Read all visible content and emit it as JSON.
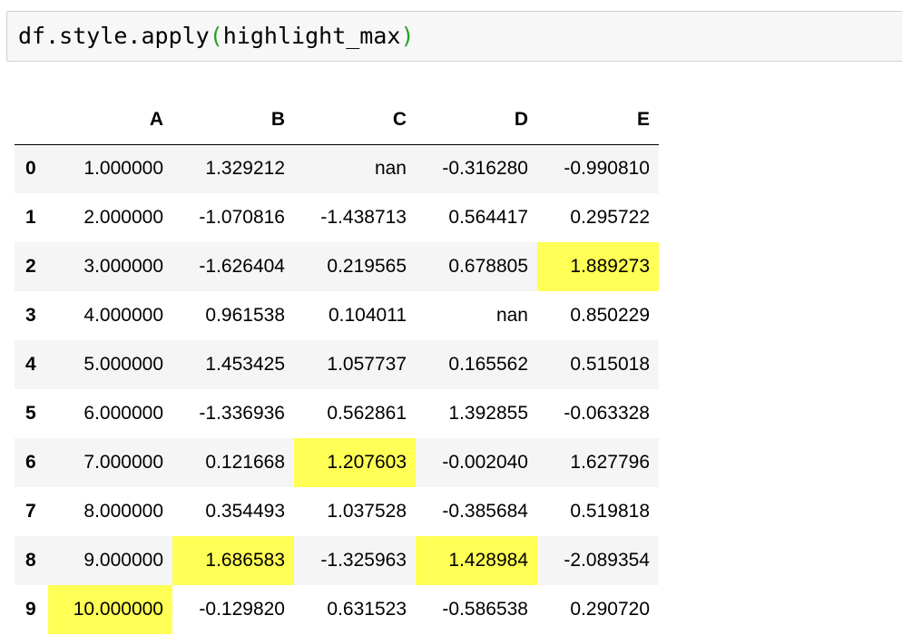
{
  "code": {
    "prefix": "df.style.apply",
    "open_paren": "(",
    "arg": "highlight_max",
    "close_paren": ")"
  },
  "colors": {
    "highlight": "#ffff55",
    "paren": "#22a02a",
    "stripe": "#f5f5f5"
  },
  "table": {
    "columns": [
      "A",
      "B",
      "C",
      "D",
      "E"
    ],
    "rows": [
      {
        "index": "0",
        "cells": [
          "1.000000",
          "1.329212",
          "nan",
          "-0.316280",
          "-0.990810"
        ],
        "highlight": [
          false,
          false,
          false,
          false,
          false
        ]
      },
      {
        "index": "1",
        "cells": [
          "2.000000",
          "-1.070816",
          "-1.438713",
          "0.564417",
          "0.295722"
        ],
        "highlight": [
          false,
          false,
          false,
          false,
          false
        ]
      },
      {
        "index": "2",
        "cells": [
          "3.000000",
          "-1.626404",
          "0.219565",
          "0.678805",
          "1.889273"
        ],
        "highlight": [
          false,
          false,
          false,
          false,
          true
        ]
      },
      {
        "index": "3",
        "cells": [
          "4.000000",
          "0.961538",
          "0.104011",
          "nan",
          "0.850229"
        ],
        "highlight": [
          false,
          false,
          false,
          false,
          false
        ]
      },
      {
        "index": "4",
        "cells": [
          "5.000000",
          "1.453425",
          "1.057737",
          "0.165562",
          "0.515018"
        ],
        "highlight": [
          false,
          false,
          false,
          false,
          false
        ]
      },
      {
        "index": "5",
        "cells": [
          "6.000000",
          "-1.336936",
          "0.562861",
          "1.392855",
          "-0.063328"
        ],
        "highlight": [
          false,
          false,
          false,
          false,
          false
        ]
      },
      {
        "index": "6",
        "cells": [
          "7.000000",
          "0.121668",
          "1.207603",
          "-0.002040",
          "1.627796"
        ],
        "highlight": [
          false,
          false,
          true,
          false,
          false
        ]
      },
      {
        "index": "7",
        "cells": [
          "8.000000",
          "0.354493",
          "1.037528",
          "-0.385684",
          "0.519818"
        ],
        "highlight": [
          false,
          false,
          false,
          false,
          false
        ]
      },
      {
        "index": "8",
        "cells": [
          "9.000000",
          "1.686583",
          "-1.325963",
          "1.428984",
          "-2.089354"
        ],
        "highlight": [
          false,
          true,
          false,
          true,
          false
        ]
      },
      {
        "index": "9",
        "cells": [
          "10.000000",
          "-0.129820",
          "0.631523",
          "-0.586538",
          "0.290720"
        ],
        "highlight": [
          true,
          false,
          false,
          false,
          false
        ]
      }
    ]
  }
}
